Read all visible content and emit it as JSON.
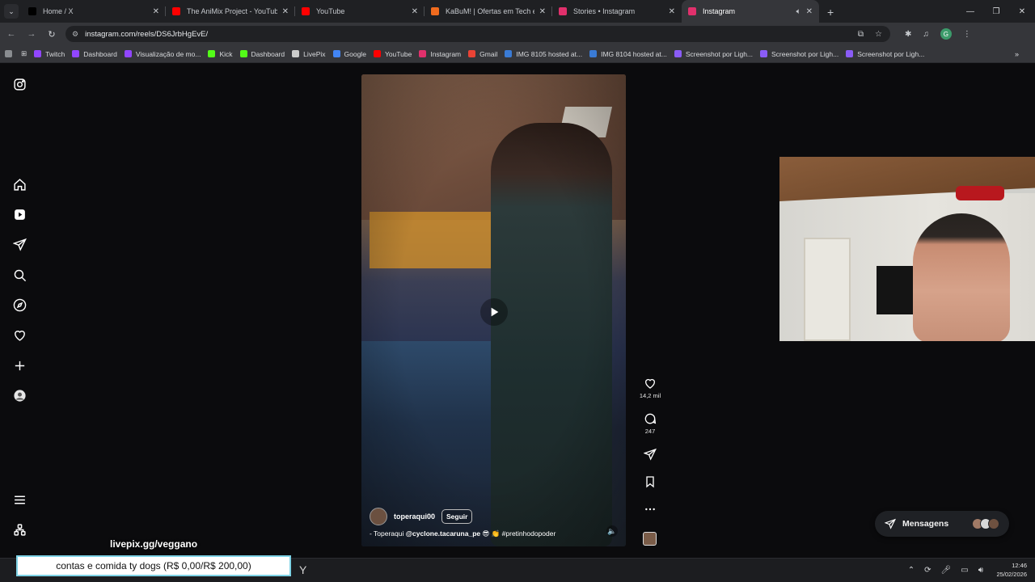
{
  "browser": {
    "tabs": [
      {
        "title": "Home / X",
        "icon": "x-logo-icon",
        "color": "#000000",
        "active": false
      },
      {
        "title": "The AniMix Project - YouTube",
        "icon": "youtube-icon",
        "color": "#ff0000",
        "active": false
      },
      {
        "title": "YouTube",
        "icon": "youtube-icon",
        "color": "#ff0000",
        "active": false
      },
      {
        "title": "KaBuM! | Ofertas em Tech e Ga",
        "icon": "kabum-icon",
        "color": "#f06b1e",
        "active": false
      },
      {
        "title": "Stories • Instagram",
        "icon": "instagram-icon",
        "color": "#e1306c",
        "active": false
      },
      {
        "title": "Instagram",
        "icon": "instagram-icon",
        "color": "#e1306c",
        "active": true
      }
    ],
    "url": "instagram.com/reels/DS6JrbHgEvE/",
    "bookmarks": [
      {
        "label": "Twitch",
        "color": "#9146ff"
      },
      {
        "label": "Dashboard",
        "color": "#9146ff"
      },
      {
        "label": "Visualização de mo...",
        "color": "#9146ff"
      },
      {
        "label": "Kick",
        "color": "#53fc18"
      },
      {
        "label": "Dashboard",
        "color": "#53fc18"
      },
      {
        "label": "LivePix",
        "color": "#cccccc"
      },
      {
        "label": "Google",
        "color": "#4285f4"
      },
      {
        "label": "YouTube",
        "color": "#ff0000"
      },
      {
        "label": "Instagram",
        "color": "#e1306c"
      },
      {
        "label": "Gmail",
        "color": "#ea4335"
      },
      {
        "label": "IMG 8105 hosted at...",
        "color": "#3a7bd5"
      },
      {
        "label": "IMG 8104 hosted at...",
        "color": "#3a7bd5"
      },
      {
        "label": "Screenshot por Ligh...",
        "color": "#8a5cf6"
      },
      {
        "label": "Screenshot por Ligh...",
        "color": "#8a5cf6"
      },
      {
        "label": "Screenshot por Ligh...",
        "color": "#8a5cf6"
      }
    ],
    "bookmarks_more": "»"
  },
  "reel": {
    "username": "toperaqui00",
    "follow_label": "Seguir",
    "caption_prefix": "- Toperaqui ",
    "caption_mention": "@cyclone.tacaruna_pe",
    "caption_suffix": " 😎 👏 #pretinhodopoder",
    "likes": "14,2 mil",
    "comments": "247"
  },
  "messages": {
    "label": "Mensagens"
  },
  "stream_overlay": {
    "livepix": "livepix.gg/veggano",
    "donation_goal": "contas e comida ty dogs (R$ 0,00/R$ 200,00)"
  },
  "taskbar": {
    "time": "12:46",
    "date": "25/02/2026"
  },
  "colors": {
    "page_bg": "#0b0b0d",
    "accent_ig": "#e1306c"
  }
}
